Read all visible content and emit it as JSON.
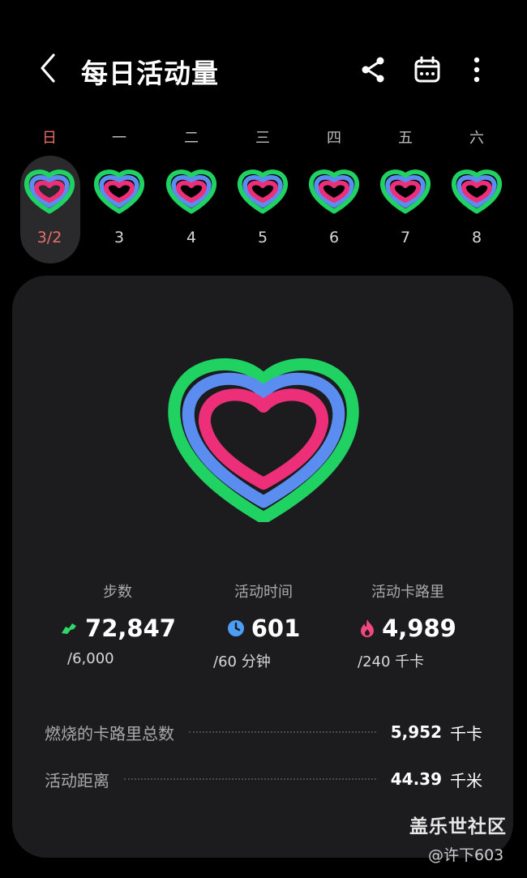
{
  "header": {
    "title": "每日活动量",
    "back_icon": "chevron-left-icon",
    "share_icon": "share-icon",
    "calendar_icon": "calendar-icon",
    "more_icon": "more-vertical-icon"
  },
  "week": [
    {
      "weekday": "日",
      "date": "3/2",
      "selected": true
    },
    {
      "weekday": "一",
      "date": "3"
    },
    {
      "weekday": "二",
      "date": "4"
    },
    {
      "weekday": "三",
      "date": "5"
    },
    {
      "weekday": "四",
      "date": "6"
    },
    {
      "weekday": "五",
      "date": "7"
    },
    {
      "weekday": "六",
      "date": "8"
    }
  ],
  "stats": {
    "steps": {
      "label": "步数",
      "value": "72,847",
      "goal": "/6,000",
      "icon": "shoe-icon",
      "color": "#2fd86a"
    },
    "active_time": {
      "label": "活动时间",
      "value": "601",
      "goal": "/60 分钟",
      "icon": "clock-icon",
      "color": "#4b9df5"
    },
    "active_calories": {
      "label": "活动卡路里",
      "value": "4,989",
      "goal": "/240 千卡",
      "icon": "flame-icon",
      "color": "#f0487f"
    }
  },
  "summary": {
    "total_calories": {
      "label": "燃烧的卡路里总数",
      "value": "5,952",
      "unit": "千卡"
    },
    "distance": {
      "label": "活动距离",
      "value": "44.39",
      "unit": "千米"
    }
  },
  "watermark": {
    "brand": "盖乐世社区",
    "user": "@许下603"
  },
  "colors": {
    "ring_outer": "#1fd262",
    "ring_middle": "#5b8cf0",
    "ring_inner": "#ec2f78",
    "selected_day": "#e8706b"
  }
}
